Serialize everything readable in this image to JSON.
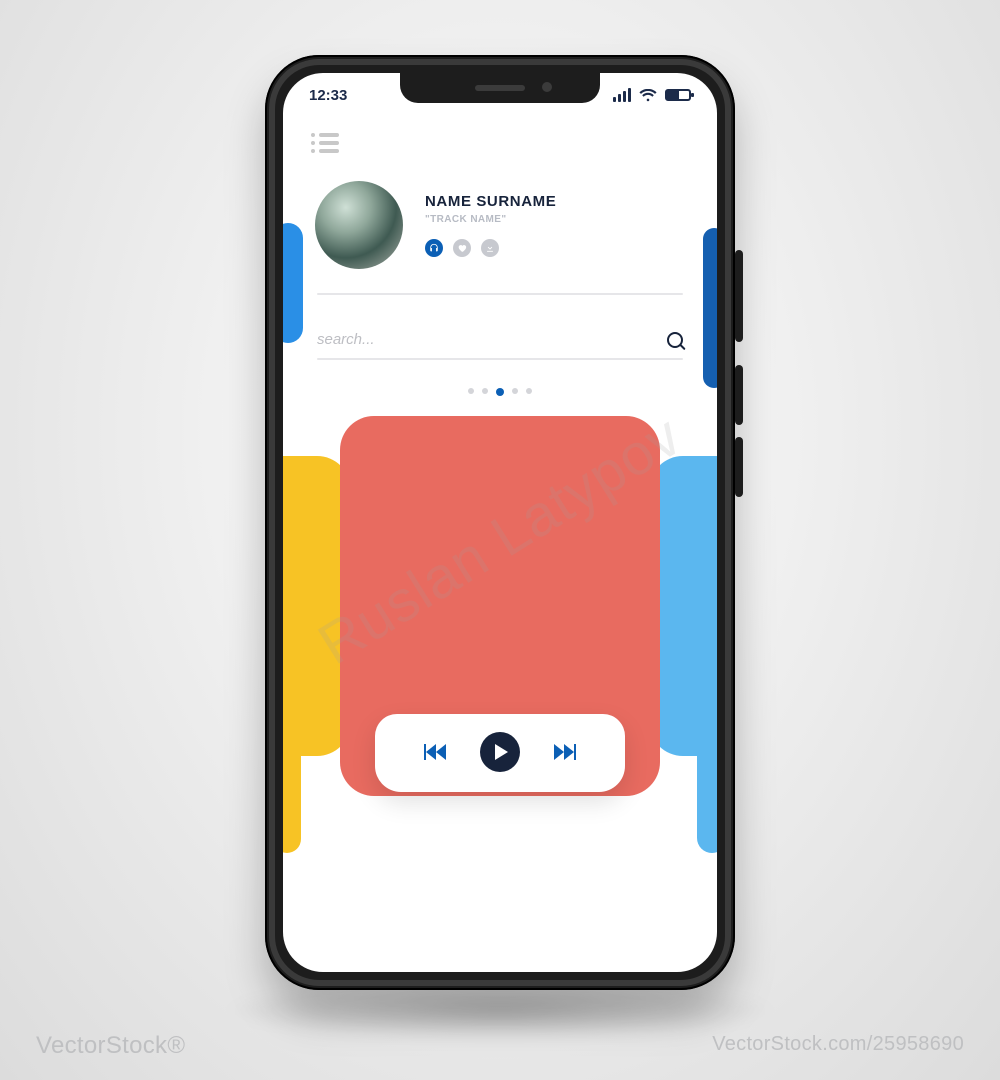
{
  "statusbar": {
    "time": "12:33"
  },
  "profile": {
    "name": "NAME SURNAME",
    "track": "\"TRACK NAME\"",
    "mini_icons": [
      "headphones",
      "heart",
      "download"
    ]
  },
  "search": {
    "placeholder": "search..."
  },
  "pager": {
    "count": 5,
    "active_index": 2
  },
  "carousel": {
    "center_color": "#e86b60",
    "left_color": "#f7c325",
    "right_color": "#5bb7ef"
  },
  "player": {
    "controls": [
      "prev",
      "play",
      "next"
    ]
  },
  "watermark": {
    "diagonal": "Ruslan Latypov",
    "bottom_left": "VectorStock®",
    "bottom_right": "VectorStock.com/25958690"
  }
}
